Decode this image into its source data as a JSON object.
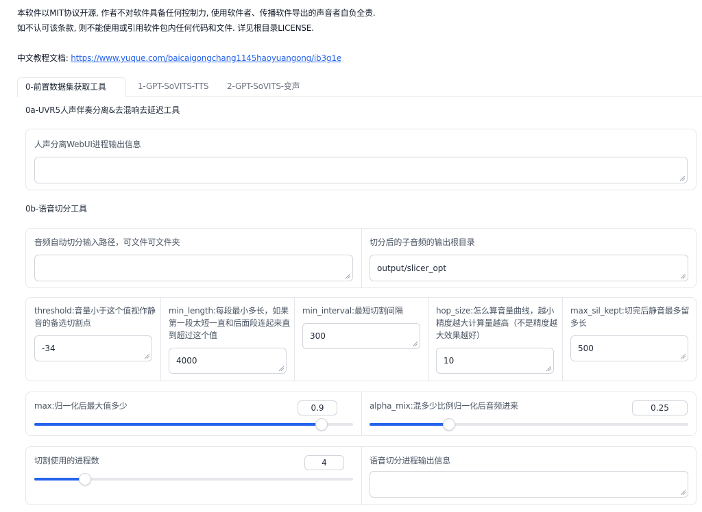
{
  "intro": {
    "line1": "本软件以MIT协议开源, 作者不对软件具备任何控制力, 使用软件者、传播软件导出的声音者自负全责.",
    "line2": "如不认可该条款, 则不能使用或引用软件包内任何代码和文件. 详见根目录LICENSE.",
    "doc_label": "中文教程文档: ",
    "doc_link": "https://www.yuque.com/baicaigongchang1145haoyuangong/ib3g1e"
  },
  "tabs": [
    {
      "label": "0-前置数据集获取工具"
    },
    {
      "label": "1-GPT-SoVITS-TTS"
    },
    {
      "label": "2-GPT-SoVITS-变声"
    }
  ],
  "uvr": {
    "title": "0a-UVR5人声伴奏分离&去混响去延迟工具",
    "output_label": "人声分离WebUI进程输出信息",
    "output_value": ""
  },
  "slicer": {
    "title": "0b-语音切分工具",
    "input_path_label": "音频自动切分输入路径，可文件可文件夹",
    "input_path_value": "",
    "output_root_label": "切分后的子音频的输出根目录",
    "output_root_value": "output/slicer_opt",
    "params": [
      {
        "label": "threshold:音量小于这个值视作静音的备选切割点",
        "value": "-34"
      },
      {
        "label": "min_length:每段最小多长，如果第一段太短一直和后面段连起来直到超过这个值",
        "value": "4000"
      },
      {
        "label": "min_interval:最短切割间隔",
        "value": "300"
      },
      {
        "label": "hop_size:怎么算音量曲线，越小精度越大计算量越高（不是精度越大效果越好）",
        "value": "10"
      },
      {
        "label": "max_sil_kept:切完后静音最多留多长",
        "value": "500"
      }
    ],
    "max_slider": {
      "label": "max:归一化后最大值多少",
      "value": "0.9",
      "fraction": 0.9
    },
    "alpha_slider": {
      "label": "alpha_mix:混多少比例归一化后音频进来",
      "value": "0.25",
      "fraction": 0.25
    },
    "proc_slider": {
      "label": "切割使用的进程数",
      "value": "4",
      "fraction": 0.16
    },
    "proc_output_label": "语音切分进程输出信息",
    "proc_output_value": ""
  }
}
